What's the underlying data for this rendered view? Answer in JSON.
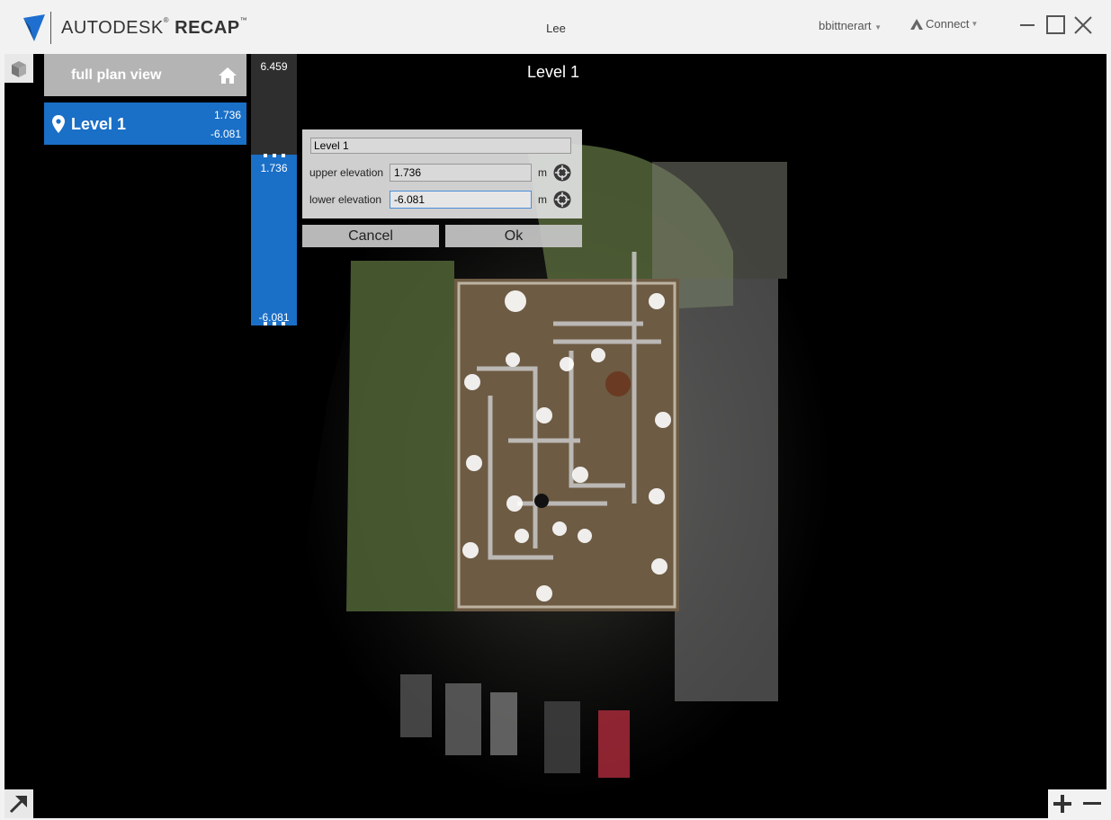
{
  "titlebar": {
    "brand_prefix": "AUTODESK",
    "brand_reg": "®",
    "brand_product": "RECAP",
    "brand_tm": "™",
    "project_name": "Lee",
    "user_name": "bbittnerart",
    "connect_label": "Connect"
  },
  "viewport": {
    "view_title": "Level 1"
  },
  "sidebar": {
    "full_plan_label": "full plan view",
    "levels": [
      {
        "label": "Level 1",
        "upper": "1.736",
        "lower": "-6.081"
      }
    ]
  },
  "elevation_bar": {
    "max": "6.459",
    "upper": "1.736",
    "lower": "-6.081"
  },
  "dialog": {
    "name_value": "Level 1",
    "upper_label": "upper elevation",
    "upper_value": "1.736",
    "lower_label": "lower elevation",
    "lower_value": "-6.081",
    "unit": "m",
    "cancel_label": "Cancel",
    "ok_label": "Ok"
  },
  "colors": {
    "accent": "#1a6fc7",
    "logo": "#1e6fd0"
  },
  "icons": [
    "autodesk-logo-icon",
    "chevron-down-icon",
    "a360-icon",
    "minimize-icon",
    "maximize-icon",
    "close-icon",
    "home-icon",
    "location-pin-icon",
    "crosshair-icon",
    "view-cube-icon",
    "expand-arrow-icon",
    "plus-icon",
    "minus-icon"
  ]
}
